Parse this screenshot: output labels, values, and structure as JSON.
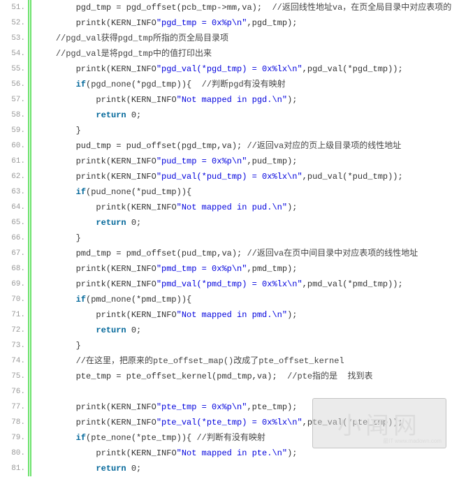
{
  "watermark": {
    "text": "小闻网",
    "sub": "最IT www.madown.com"
  },
  "lines": [
    {
      "n": "51.",
      "ind": 2,
      "segs": [
        {
          "t": "pgd_tmp = pgd_offset(pcb_tmp->mm,va);  "
        },
        {
          "t": "//返回线性地址va，在页全局目录中对应表项的",
          "c": "cmt"
        }
      ]
    },
    {
      "n": "52.",
      "ind": 2,
      "segs": [
        {
          "t": "printk(KERN_INFO"
        },
        {
          "t": "\"pgd_tmp = 0x%p\\n\"",
          "c": "str"
        },
        {
          "t": ",pgd_tmp);"
        }
      ]
    },
    {
      "n": "53.",
      "ind": 1,
      "segs": [
        {
          "t": "//pgd_val获得pgd_tmp所指的页全局目录项",
          "c": "cmt"
        }
      ]
    },
    {
      "n": "54.",
      "ind": 1,
      "segs": [
        {
          "t": "//pgd_val是将pgd_tmp中的值打印出来",
          "c": "cmt"
        }
      ]
    },
    {
      "n": "55.",
      "ind": 2,
      "segs": [
        {
          "t": "printk(KERN_INFO"
        },
        {
          "t": "\"pgd_val(*pgd_tmp) = 0x%lx\\n\"",
          "c": "str"
        },
        {
          "t": ",pgd_val(*pgd_tmp));"
        }
      ]
    },
    {
      "n": "56.",
      "ind": 2,
      "segs": [
        {
          "t": "if"
        },
        {
          "t": "(pgd_none(*pgd_tmp)){  "
        },
        {
          "t": "//判断pgd有没有映射",
          "c": "cmt"
        }
      ],
      "kw0": true
    },
    {
      "n": "57.",
      "ind": 3,
      "segs": [
        {
          "t": "printk(KERN_INFO"
        },
        {
          "t": "\"Not mapped in pgd.\\n\"",
          "c": "str"
        },
        {
          "t": ");"
        }
      ]
    },
    {
      "n": "58.",
      "ind": 3,
      "segs": [
        {
          "t": "return",
          "c": "kw"
        },
        {
          "t": " 0;"
        }
      ]
    },
    {
      "n": "59.",
      "ind": 2,
      "segs": [
        {
          "t": "}"
        }
      ]
    },
    {
      "n": "60.",
      "ind": 2,
      "segs": [
        {
          "t": "pud_tmp = pud_offset(pgd_tmp,va); "
        },
        {
          "t": "//返回va对应的页上级目录项的线性地址",
          "c": "cmt"
        }
      ]
    },
    {
      "n": "61.",
      "ind": 2,
      "segs": [
        {
          "t": "printk(KERN_INFO"
        },
        {
          "t": "\"pud_tmp = 0x%p\\n\"",
          "c": "str"
        },
        {
          "t": ",pud_tmp);"
        }
      ]
    },
    {
      "n": "62.",
      "ind": 2,
      "segs": [
        {
          "t": "printk(KERN_INFO"
        },
        {
          "t": "\"pud_val(*pud_tmp) = 0x%lx\\n\"",
          "c": "str"
        },
        {
          "t": ",pud_val(*pud_tmp));"
        }
      ]
    },
    {
      "n": "63.",
      "ind": 2,
      "segs": [
        {
          "t": "if",
          "c": "kw"
        },
        {
          "t": "(pud_none(*pud_tmp)){"
        }
      ]
    },
    {
      "n": "64.",
      "ind": 3,
      "segs": [
        {
          "t": "printk(KERN_INFO"
        },
        {
          "t": "\"Not mapped in pud.\\n\"",
          "c": "str"
        },
        {
          "t": ");"
        }
      ]
    },
    {
      "n": "65.",
      "ind": 3,
      "segs": [
        {
          "t": "return",
          "c": "kw"
        },
        {
          "t": " 0;"
        }
      ]
    },
    {
      "n": "66.",
      "ind": 2,
      "segs": [
        {
          "t": "}"
        }
      ]
    },
    {
      "n": "67.",
      "ind": 2,
      "segs": [
        {
          "t": "pmd_tmp = pmd_offset(pud_tmp,va); "
        },
        {
          "t": "//返回va在页中间目录中对应表项的线性地址",
          "c": "cmt"
        }
      ]
    },
    {
      "n": "68.",
      "ind": 2,
      "segs": [
        {
          "t": "printk(KERN_INFO"
        },
        {
          "t": "\"pmd_tmp = 0x%p\\n\"",
          "c": "str"
        },
        {
          "t": ",pmd_tmp);"
        }
      ]
    },
    {
      "n": "69.",
      "ind": 2,
      "segs": [
        {
          "t": "printk(KERN_INFO"
        },
        {
          "t": "\"pmd_val(*pmd_tmp) = 0x%lx\\n\"",
          "c": "str"
        },
        {
          "t": ",pmd_val(*pmd_tmp));"
        }
      ]
    },
    {
      "n": "70.",
      "ind": 2,
      "segs": [
        {
          "t": "if",
          "c": "kw"
        },
        {
          "t": "(pmd_none(*pmd_tmp)){"
        }
      ]
    },
    {
      "n": "71.",
      "ind": 3,
      "segs": [
        {
          "t": "printk(KERN_INFO"
        },
        {
          "t": "\"Not mapped in pmd.\\n\"",
          "c": "str"
        },
        {
          "t": ");"
        }
      ]
    },
    {
      "n": "72.",
      "ind": 3,
      "segs": [
        {
          "t": "return",
          "c": "kw"
        },
        {
          "t": " 0;"
        }
      ]
    },
    {
      "n": "73.",
      "ind": 2,
      "segs": [
        {
          "t": "}"
        }
      ]
    },
    {
      "n": "74.",
      "ind": 2,
      "segs": [
        {
          "t": "//在这里，把原来的pte_offset_map()改成了pte_offset_kernel",
          "c": "cmt"
        }
      ]
    },
    {
      "n": "75.",
      "ind": 2,
      "segs": [
        {
          "t": "pte_tmp = pte_offset_kernel(pmd_tmp,va);  "
        },
        {
          "t": "//pte指的是  找到表",
          "c": "cmt"
        }
      ]
    },
    {
      "n": "76.",
      "ind": 0,
      "segs": [
        {
          "t": " "
        }
      ]
    },
    {
      "n": "77.",
      "ind": 2,
      "segs": [
        {
          "t": "printk(KERN_INFO"
        },
        {
          "t": "\"pte_tmp = 0x%p\\n\"",
          "c": "str"
        },
        {
          "t": ",pte_tmp);"
        }
      ]
    },
    {
      "n": "78.",
      "ind": 2,
      "segs": [
        {
          "t": "printk(KERN_INFO"
        },
        {
          "t": "\"pte_val(*pte_tmp) = 0x%lx\\n\"",
          "c": "str"
        },
        {
          "t": ",pte_val(*pte_tmp));"
        }
      ]
    },
    {
      "n": "79.",
      "ind": 2,
      "segs": [
        {
          "t": "if",
          "c": "kw"
        },
        {
          "t": "(pte_none(*pte_tmp)){ "
        },
        {
          "t": "//判断有没有映射",
          "c": "cmt"
        }
      ]
    },
    {
      "n": "80.",
      "ind": 3,
      "segs": [
        {
          "t": "printk(KERN_INFO"
        },
        {
          "t": "\"Not mapped in pte.\\n\"",
          "c": "str"
        },
        {
          "t": ");"
        }
      ]
    },
    {
      "n": "81.",
      "ind": 3,
      "segs": [
        {
          "t": "return",
          "c": "kw"
        },
        {
          "t": " 0;"
        }
      ]
    }
  ]
}
